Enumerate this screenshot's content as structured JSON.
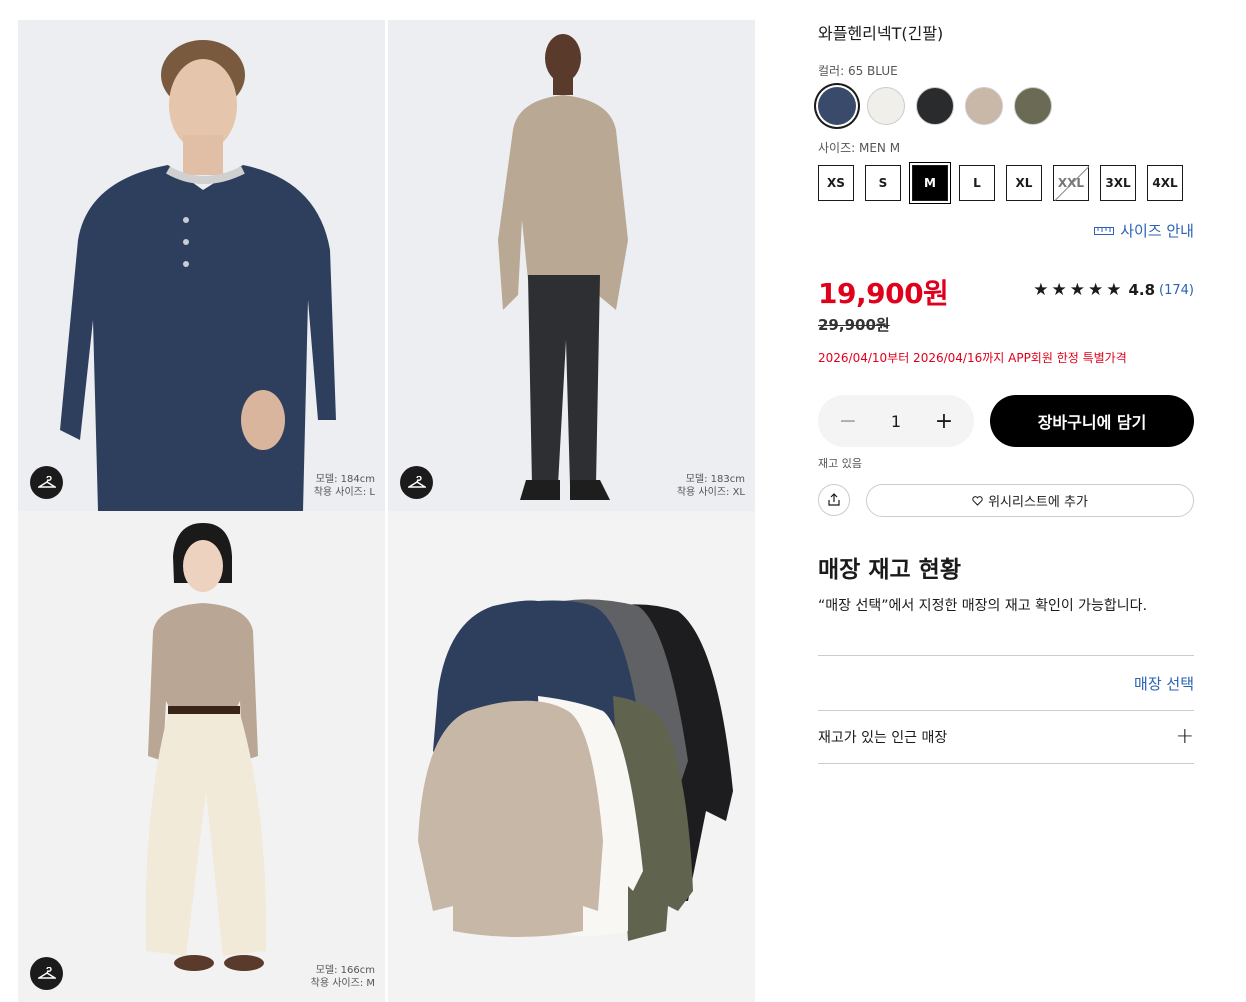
{
  "gallery": {
    "tiles": [
      {
        "model_height": "모델: 184cm",
        "wear_size": "착용 사이즈: L"
      },
      {
        "model_height": "모델: 183cm",
        "wear_size": "착용 사이즈: XL"
      },
      {
        "model_height": "모델: 166cm",
        "wear_size": "착용 사이즈: M"
      },
      {}
    ],
    "icon": "hanger-icon"
  },
  "product": {
    "title": "와플헨리넥T(긴팔)",
    "color_label": "컬러: 65 BLUE",
    "colors": [
      {
        "name": "blue",
        "hex": "#3a4a6b",
        "selected": true
      },
      {
        "name": "off-white",
        "hex": "#f0efe9"
      },
      {
        "name": "black",
        "hex": "#2a2b2d"
      },
      {
        "name": "beige",
        "hex": "#c9b8a8"
      },
      {
        "name": "olive",
        "hex": "#6b6b55"
      }
    ],
    "size_label": "사이즈: MEN M",
    "sizes": [
      "XS",
      "S",
      "M",
      "L",
      "XL",
      "XXL",
      "3XL",
      "4XL"
    ],
    "selected_size": "M",
    "sold_out_size": "XXL",
    "size_guide": "사이즈 안내",
    "price": "19,900원",
    "original_price": "29,900원",
    "promo": "2026/04/10부터 2026/04/16까지 APP회원 한정 특별가격",
    "rating": {
      "stars": "★★★★★",
      "score": "4.8",
      "count": "(174)"
    },
    "quantity": "1",
    "add_to_cart": "장바구니에 담기",
    "stock_status": "재고 있음",
    "wishlist": "위시리스트에 추가"
  },
  "store": {
    "title": "매장 재고 현황",
    "description": "“매장 선택”에서 지정한 매장의 재고 확인이 가능합니다.",
    "select_store": "매장 선택",
    "nearby": "재고가 있는 인근 매장"
  },
  "colors": {
    "price_red": "#e0001b",
    "link_blue": "#2a62b4"
  }
}
